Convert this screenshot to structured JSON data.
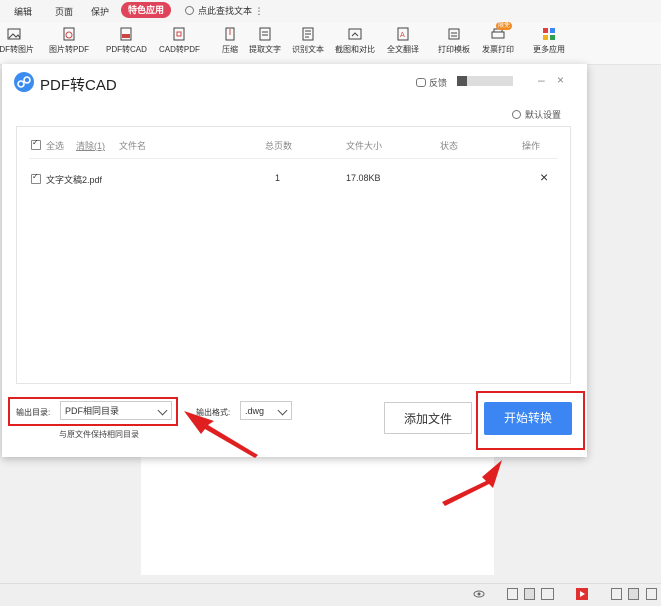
{
  "menubar": {
    "items": [
      "编辑",
      "页面",
      "保护"
    ],
    "special_label": "特色应用",
    "search_label": "点此查找文本",
    "more_glyph": "⋮"
  },
  "toolbar": {
    "tools": [
      {
        "label": "PDF转图片",
        "icon": "image-icon"
      },
      {
        "label": "图片转PDF",
        "icon": "image-to-pdf-icon"
      },
      {
        "label": "PDF转CAD",
        "icon": "pdf-to-cad-icon"
      },
      {
        "label": "CAD转PDF",
        "icon": "cad-to-pdf-icon"
      },
      {
        "label": "压缩",
        "icon": "compress-icon"
      },
      {
        "label": "提取文字",
        "icon": "extract-text-icon"
      },
      {
        "label": "识别文本",
        "icon": "ocr-icon"
      },
      {
        "label": "截图和对比",
        "icon": "screenshot-icon"
      },
      {
        "label": "全文翻译",
        "icon": "translate-icon"
      },
      {
        "label": "打印模板",
        "icon": "print-template-icon"
      },
      {
        "label": "发票打印",
        "icon": "invoice-print-icon",
        "badge": "限免"
      },
      {
        "label": "更多应用",
        "icon": "apps-icon"
      }
    ]
  },
  "dialog": {
    "title": "PDF转CAD",
    "feedback_label": "反馈",
    "minimize_glyph": "–",
    "close_glyph": "×",
    "settings_label": "默认设置",
    "table": {
      "select_all": "全选",
      "clear": "清除(1)",
      "columns": [
        "文件名",
        "总页数",
        "文件大小",
        "状态",
        "操作"
      ],
      "rows": [
        {
          "filename": "文字文稿2.pdf",
          "pages": "1",
          "size": "17.08KB",
          "status": "",
          "action_glyph": "×"
        }
      ]
    },
    "output_dir_label": "输出目录:",
    "output_dir_value": "PDF相同目录",
    "output_dir_hint": "与原文件保持相同目录",
    "output_format_label": "输出格式:",
    "output_format_value": ".dwg",
    "add_file_label": "添加文件",
    "start_label": "开始转换"
  },
  "colors": {
    "accent": "#3b86f2",
    "special": "#e0445a",
    "annotation": "#e02020"
  }
}
